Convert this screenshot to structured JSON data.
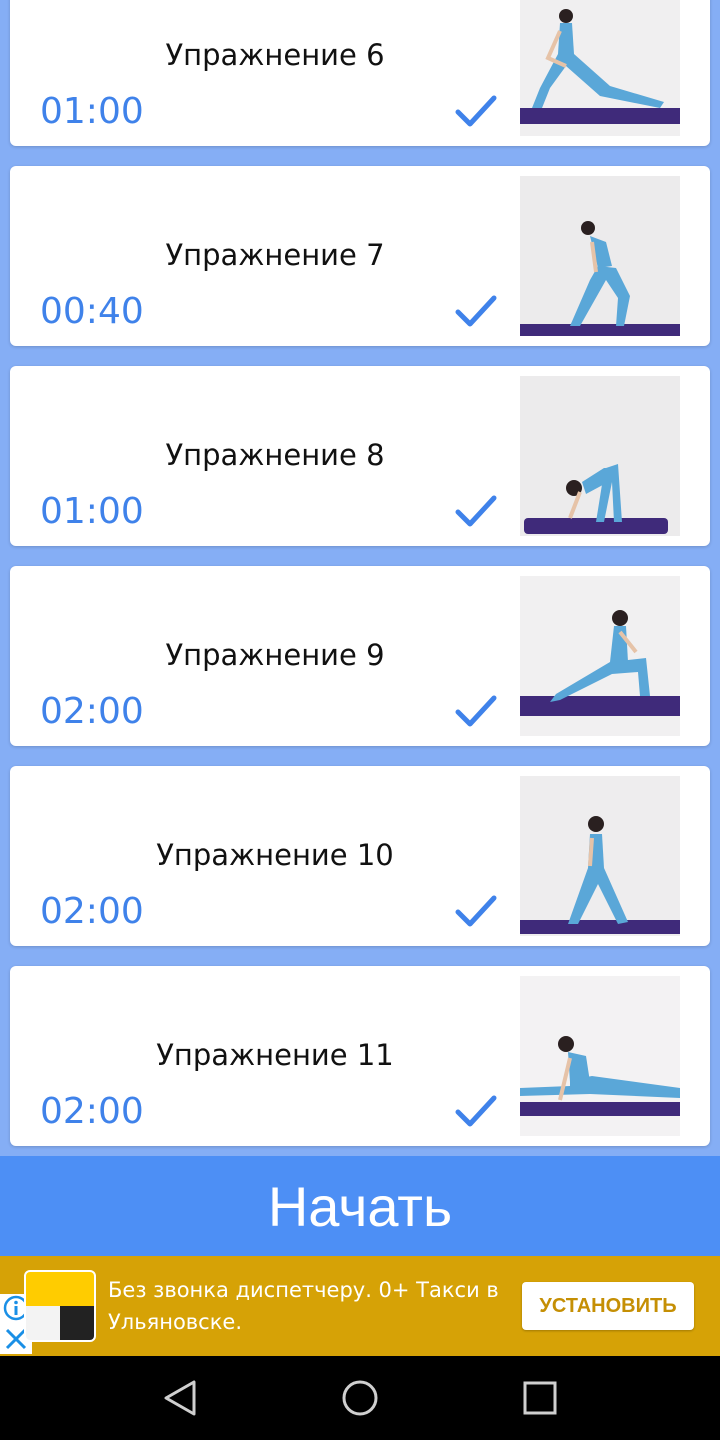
{
  "exercises": [
    {
      "title": "Упражнение 6",
      "time": "01:00",
      "done": true
    },
    {
      "title": "Упражнение 7",
      "time": "00:40",
      "done": true
    },
    {
      "title": "Упражнение 8",
      "time": "01:00",
      "done": true
    },
    {
      "title": "Упражнение 9",
      "time": "02:00",
      "done": true
    },
    {
      "title": "Упражнение 10",
      "time": "02:00",
      "done": true
    },
    {
      "title": "Упражнение 11",
      "time": "02:00",
      "done": true
    }
  ],
  "start_button": {
    "label": "Начать"
  },
  "ad": {
    "text": "Без звонка диспетчеру. 0+ Такси в Ульяновске.",
    "install_label": "УСТАНОВИТЬ"
  },
  "colors": {
    "background": "#85aef5",
    "accent": "#4d8ff5",
    "time_text": "#3f82ea",
    "ad_background": "#d6a206",
    "mat": "#3f2a7a",
    "outfit": "#5aa7d8"
  },
  "icons": {
    "check": "check-icon",
    "ad_info": "info-icon",
    "ad_close": "close-icon",
    "nav_back": "back-triangle-icon",
    "nav_home": "home-circle-icon",
    "nav_recents": "recents-square-icon"
  }
}
